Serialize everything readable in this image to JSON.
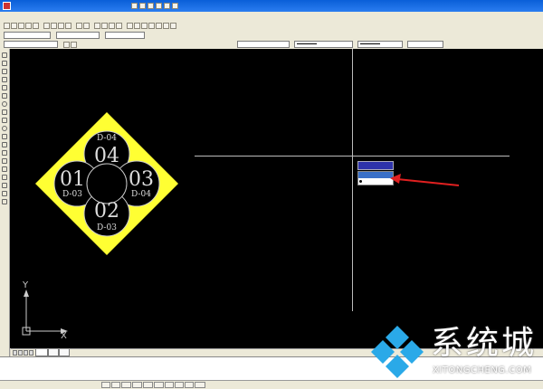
{
  "drawing": {
    "blocks": [
      {
        "big": "04",
        "small": "D-04",
        "pos": "top"
      },
      {
        "big": "01",
        "small": "D-03",
        "pos": "left"
      },
      {
        "big": "03",
        "small": "D-04",
        "pos": "right"
      },
      {
        "big": "02",
        "small": "D-03",
        "pos": "bottom"
      }
    ]
  },
  "ucs": {
    "x_label": "X",
    "y_label": "Y"
  },
  "watermark": {
    "title": "系统城",
    "url": "XITONGCHENG.COM"
  },
  "colors": {
    "canvas": "#000000",
    "highlight": "#ffff33",
    "linework": "#cccccc",
    "arrow": "#e02020",
    "menu_head": "#2e33aa"
  }
}
